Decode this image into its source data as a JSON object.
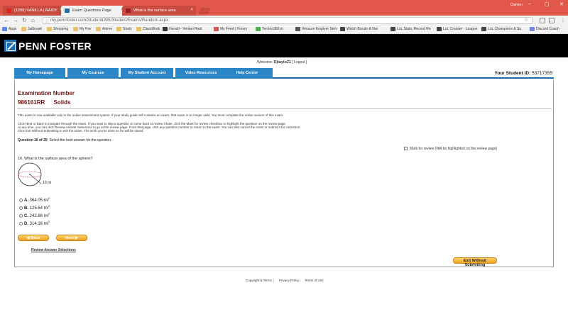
{
  "browser": {
    "tabs": [
      {
        "title": "(1289) VANILLA | RAIDY",
        "favicon_color": "#e62117",
        "active": false
      },
      {
        "title": "Exam Questions Page",
        "favicon_color": "#1b6cb0",
        "active": true
      },
      {
        "title": "What is the surface area",
        "favicon_color": "#9b1b30",
        "active": false
      }
    ],
    "user": "Darren",
    "url": "my.pennfoster.com/StudentLMS/Student/Exams/Random.aspx",
    "bookmarks": [
      "Apps",
      "Jailbreak",
      "Shopping",
      "My Fav",
      "Anime",
      "Study",
      "ClassWork",
      "Herald - Ventari Raid",
      "My Feed | Honey",
      "Techno360.in",
      "Vensure Emplyer Serv",
      "Watch Boruto & Nar",
      "LoL Stats, Record Re",
      "LoL Counter - League",
      "LoL Champions & Su",
      "Discord Coach"
    ]
  },
  "site": {
    "logo_text": "PENN FOSTER",
    "welcome_prefix": "Welcome:",
    "username": "Djtaylo21",
    "logout": "[ Logout ]",
    "nav": [
      "My Homepage",
      "My Courses",
      "My Student Account",
      "Video Resources",
      "Help Center"
    ],
    "student_id_label": "Your Student ID:",
    "student_id": "53717355"
  },
  "exam": {
    "title": "Examination Number",
    "number": "986161RR",
    "subject": "Solids",
    "notice": "This exam is now available only in the online assessment system. If your study guide still contains an exam, that exam is no longer valid. You must complete the online version of this exam.",
    "instructions": [
      "Click Next or Back to navigate through the exam. If you want to skip a question or come back to review it later, click the Mark for review checkbox to highlight the question on the review page.",
      "At any time, you can click Review Answer Selections to go to the review page. From that page, click any question number to return to the exam. You can also cancel the exam or submit it for correction.",
      "Click Exit Without Submitting to exit the exam. The work you've done so far will be saved."
    ],
    "question_progress": "Question 16 of 20",
    "question_prompt": ": Select the best answer for the question.",
    "mark_review": "Mark for review (Will be highlighted on the review page)",
    "question_text": "16.   What is the surface area of the sphere?",
    "radius_label": "10 mi",
    "options": [
      {
        "letter": "A.",
        "value": "364.05 mi"
      },
      {
        "letter": "B.",
        "value": "125.64 mi"
      },
      {
        "letter": "C.",
        "value": "242.68 mi"
      },
      {
        "letter": "D.",
        "value": "314.16 mi"
      }
    ],
    "back_label": "Back",
    "next_label": "Next",
    "review_link": "Review Answer Selections",
    "exit_label": "Exit Without Submitting"
  },
  "footer": {
    "links": [
      "Copyright & Terms",
      "Privacy Policy",
      "Terms of Use"
    ],
    "separator": "|"
  },
  "colors": {
    "browser_frame": "#e1584a",
    "nav_tab": "#2b86c8",
    "exam_title": "#6b1a1a",
    "button_orange": "#f0a020"
  }
}
